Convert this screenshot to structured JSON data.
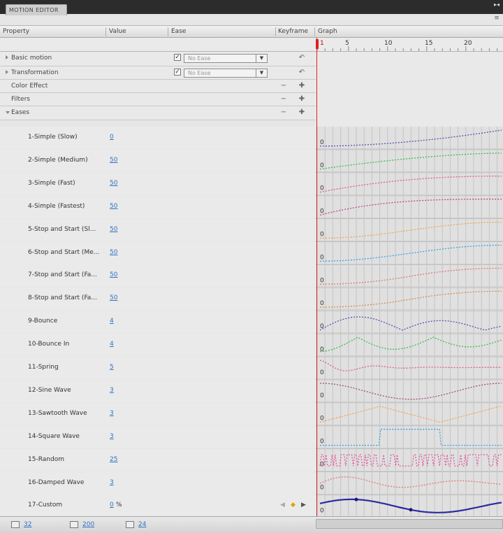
{
  "panel_title": "MOTION EDITOR",
  "columns": {
    "property": "Property",
    "value": "Value",
    "ease": "Ease",
    "keyframe": "Keyframe",
    "graph": "Graph"
  },
  "ruler": {
    "current_frame": "1",
    "marks": [
      "5",
      "10",
      "15",
      "20"
    ]
  },
  "categories": [
    {
      "label": "Basic motion",
      "ease": "No Ease"
    },
    {
      "label": "Transformation",
      "ease": "No Ease"
    },
    {
      "label": "Color Effect"
    },
    {
      "label": "Filters"
    },
    {
      "label": "Eases"
    }
  ],
  "eases": [
    {
      "name": "1-Simple (Slow)",
      "value": "0",
      "color": "#5a4fb0",
      "type": "slow"
    },
    {
      "name": "2-Simple (Medium)",
      "value": "50",
      "color": "#3bbb48",
      "type": "med"
    },
    {
      "name": "3-Simple (Fast)",
      "value": "50",
      "color": "#e0607a",
      "type": "fast"
    },
    {
      "name": "4-Simple (Fastest)",
      "value": "50",
      "color": "#c0468a",
      "type": "fastest"
    },
    {
      "name": "5-Stop and Start (Sl...",
      "value": "50",
      "color": "#f0a25a",
      "type": "ss"
    },
    {
      "name": "6-Stop and Start (Me...",
      "value": "50",
      "color": "#3aa0e0",
      "type": "ss"
    },
    {
      "name": "7-Stop and Start (Fa...",
      "value": "50",
      "color": "#e07878",
      "type": "ss2"
    },
    {
      "name": "8-Stop and Start (Fa...",
      "value": "50",
      "color": "#d88a50",
      "type": "ss2"
    },
    {
      "name": "9-Bounce",
      "value": "4",
      "color": "#5a4fb0",
      "type": "bounce"
    },
    {
      "name": "10-Bounce In",
      "value": "4",
      "color": "#3bbb48",
      "type": "bouncein"
    },
    {
      "name": "11-Spring",
      "value": "5",
      "color": "#e0607a",
      "type": "spring"
    },
    {
      "name": "12-Sine Wave",
      "value": "3",
      "color": "#a04a80",
      "type": "sine"
    },
    {
      "name": "13-Sawtooth Wave",
      "value": "3",
      "color": "#f0a25a",
      "type": "saw"
    },
    {
      "name": "14-Square Wave",
      "value": "3",
      "color": "#3aa0e0",
      "type": "square"
    },
    {
      "name": "15-Random",
      "value": "25",
      "color": "#e05a9a",
      "type": "random"
    },
    {
      "name": "16-Damped Wave",
      "value": "3",
      "color": "#e07878",
      "type": "damped"
    },
    {
      "name": "17-Custom",
      "value": "0",
      "unit": "%",
      "color": "#2a2aa0",
      "type": "custom"
    }
  ],
  "graph_zero_label": "0",
  "bottom": {
    "graph_size": "32",
    "expanded_size": "200",
    "viewable_frames": "24"
  }
}
